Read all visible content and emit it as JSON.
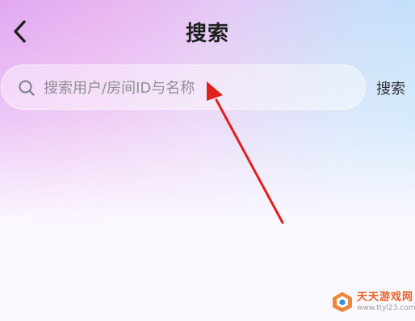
{
  "header": {
    "title": "搜索",
    "back_icon": "chevron-left-icon"
  },
  "search": {
    "placeholder": "搜索用户/房间ID与名称",
    "value": "",
    "icon": "search-icon",
    "button_label": "搜索"
  },
  "annotation": {
    "arrow_color": "#e0201c"
  },
  "watermark": {
    "title": "天天游戏网",
    "url": "www.ttyl23.com"
  },
  "colors": {
    "gradient_left": "#e2a8f2",
    "gradient_right": "#bfe2fb",
    "background_bottom": "#fbf9ff"
  }
}
